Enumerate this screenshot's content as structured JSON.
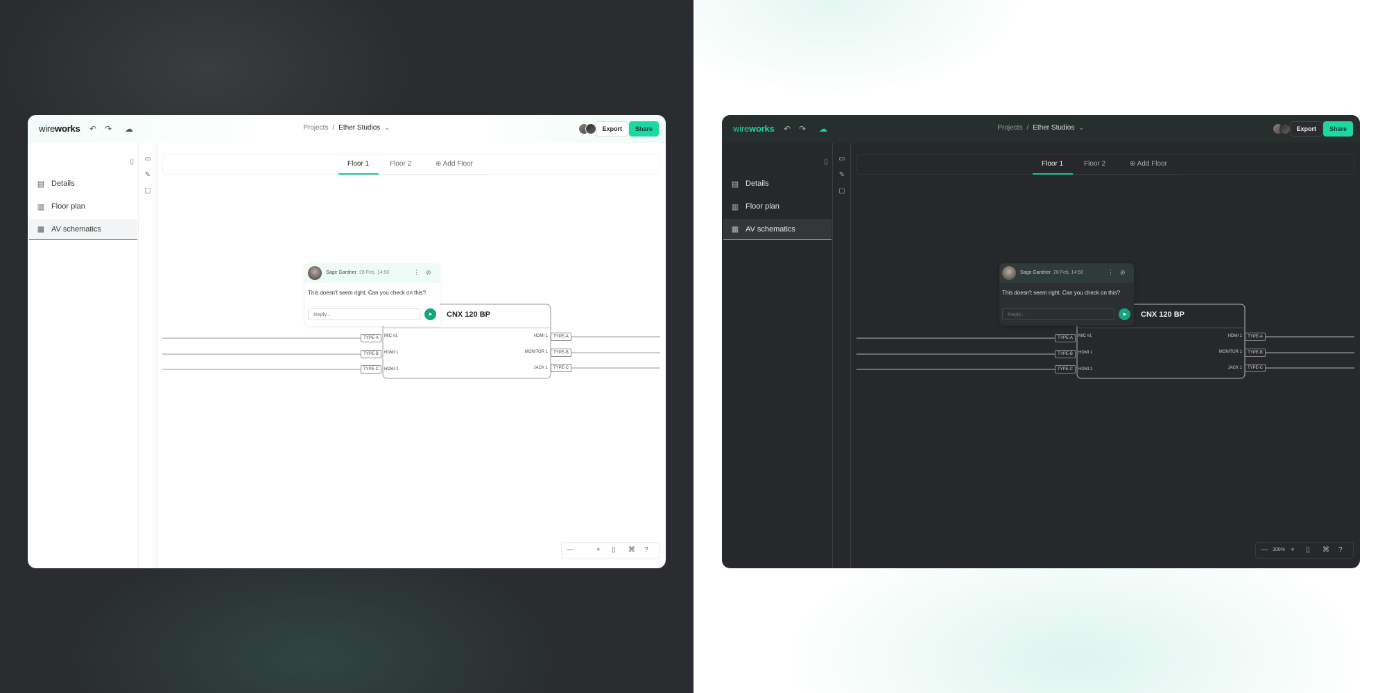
{
  "logo": {
    "part1": "wire",
    "part2": "works"
  },
  "breadcrumb": {
    "projects": "Projects",
    "separator": "/",
    "current": "Ether Studios"
  },
  "toolbar": {
    "export_label": "Export",
    "share_label": "Share"
  },
  "sidebar": {
    "items": [
      {
        "label": "Details",
        "icon": "clipboard-icon"
      },
      {
        "label": "Floor plan",
        "icon": "building-icon"
      },
      {
        "label": "AV schematics",
        "icon": "schematic-icon"
      }
    ],
    "active_index": 2
  },
  "floors": {
    "tabs": [
      "Floor 1",
      "Floor 2"
    ],
    "active": "Floor 1",
    "add_label": "Add Floor"
  },
  "comment": {
    "author": "Sage Gardner",
    "date": "28 Feb, 14:50",
    "text": "This doesn't seem right. Can you check on this?",
    "reply_placeholder": "Reply..."
  },
  "device": {
    "name": "CNX 120 BP",
    "inputs": [
      {
        "port": "MIC #1",
        "tag": "TYPE-A"
      },
      {
        "port": "HDMI 1",
        "tag": "TYPE-B"
      },
      {
        "port": "HDMI 2",
        "tag": "TYPE-C"
      }
    ],
    "outputs": [
      {
        "port": "HDMI 1",
        "tag": "TYPE-A"
      },
      {
        "port": "MONITOR 1",
        "tag": "TYPE-B"
      },
      {
        "port": "JACK 1",
        "tag": "TYPE-C"
      }
    ]
  },
  "zoom": {
    "level": "300%"
  },
  "colors": {
    "accent": "#1ed8a4",
    "accent_dark": "#12a57e",
    "dark_bg": "#26282b",
    "light_bg": "#ffffff"
  }
}
